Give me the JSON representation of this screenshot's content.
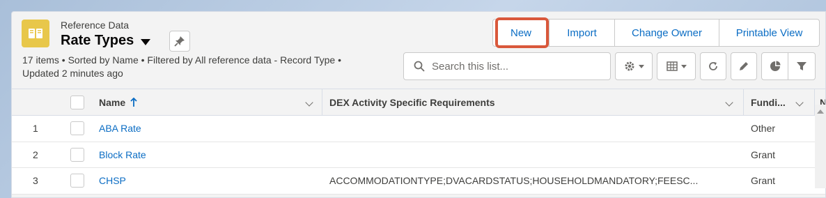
{
  "header": {
    "object_label": "Reference Data",
    "title": "Rate Types",
    "meta_line1": "17 items • Sorted by Name • Filtered by All reference data - Record Type •",
    "meta_line2": "Updated 2 minutes ago"
  },
  "actions": {
    "new_label": "New",
    "import_label": "Import",
    "change_owner_label": "Change Owner",
    "printable_view_label": "Printable View"
  },
  "search": {
    "placeholder": "Search this list..."
  },
  "columns": {
    "name": "Name",
    "dex": "DEX Activity Specific Requirements",
    "funding": "Fundi...",
    "next": "N"
  },
  "rows": [
    {
      "num": "1",
      "name": "ABA Rate",
      "dex": "",
      "funding": "Other"
    },
    {
      "num": "2",
      "name": "Block Rate",
      "dex": "",
      "funding": "Grant"
    },
    {
      "num": "3",
      "name": "CHSP",
      "dex": "ACCOMMODATIONTYPE;DVACARDSTATUS;HOUSEHOLDMANDATORY;FEESC...",
      "funding": "Grant"
    }
  ],
  "colors": {
    "accent_link": "#0b6dc4",
    "highlight": "#d9583b",
    "object_icon": "#e8c74a"
  },
  "icons": {
    "object": "book-icon",
    "pin": "pin-icon",
    "search": "search-icon",
    "settings": "gear-icon",
    "display": "table-view-icon",
    "refresh": "refresh-icon",
    "edit": "pencil-icon",
    "chart": "pie-chart-icon",
    "filter": "filter-icon",
    "sort": "sort-arrow-up-icon"
  }
}
